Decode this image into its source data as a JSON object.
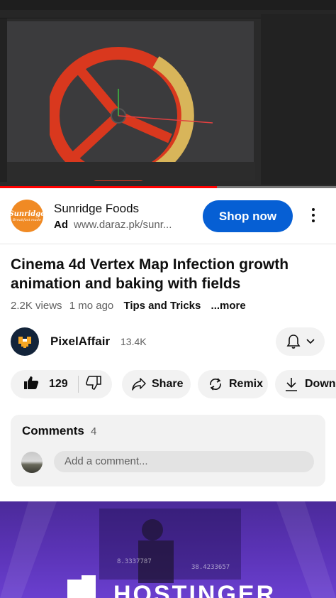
{
  "player": {
    "progress_fraction": 0.645
  },
  "ad": {
    "logo_text": "Sunridge",
    "logo_tagline": "Breakfast made",
    "title": "Sunridge Foods",
    "badge": "Ad",
    "url": "www.daraz.pk/sunr...",
    "cta": "Shop now"
  },
  "video": {
    "title": "Cinema 4d Vertex Map Infection growth animation and baking with fields",
    "views": "2.2K views",
    "age": "1 mo ago",
    "tag": "Tips and Tricks",
    "more": "...more"
  },
  "channel": {
    "name": "PixelAffair",
    "subscribers": "13.4K"
  },
  "actions": {
    "likes": "129",
    "share": "Share",
    "remix": "Remix",
    "download": "Down"
  },
  "comments": {
    "header": "Comments",
    "count": "4",
    "placeholder": "Add a comment..."
  },
  "banner": {
    "brand": "HOSTINGER",
    "watermark_1": "8.3337787",
    "watermark_2": "38.4233657"
  },
  "colors": {
    "accent": "#065fd4",
    "progress": "#ff0000",
    "ad_logo": "#f08a24",
    "banner": "#5a33b5"
  }
}
